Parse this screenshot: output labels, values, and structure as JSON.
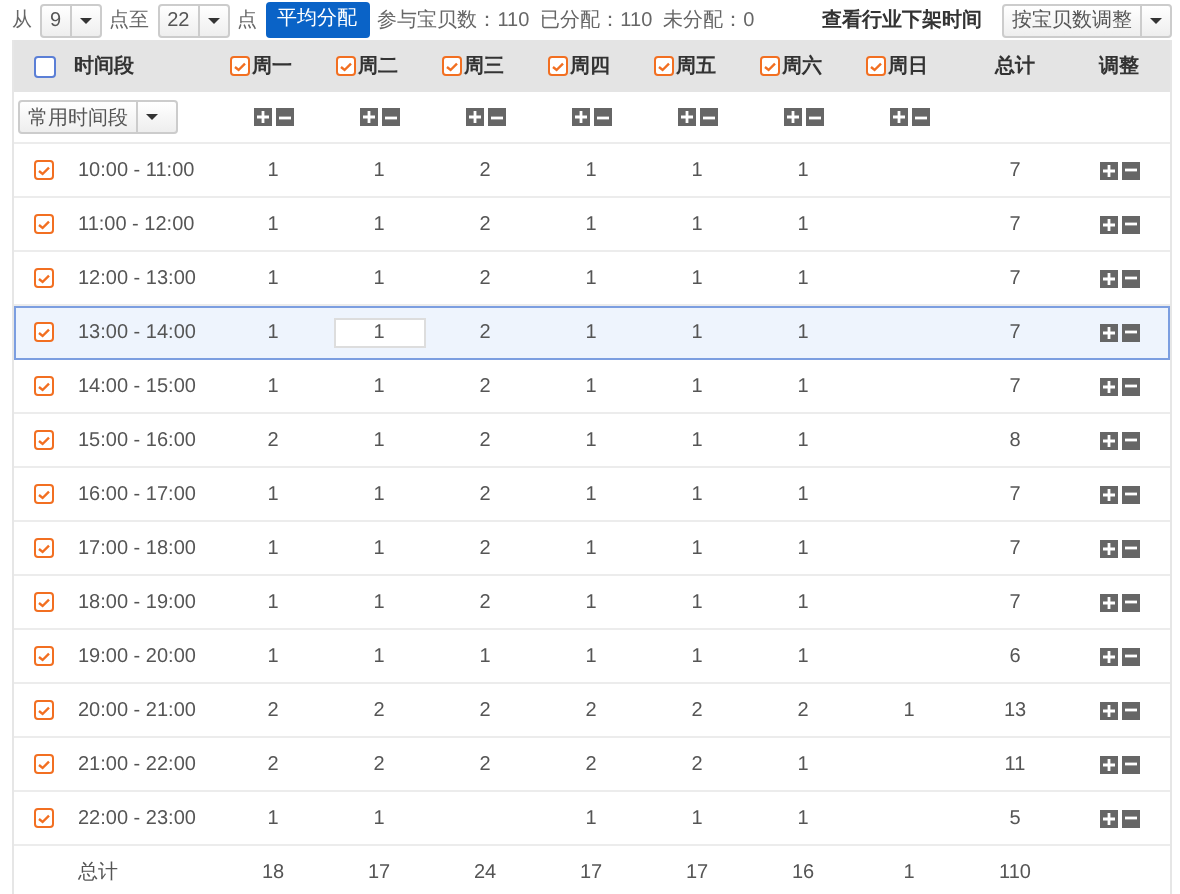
{
  "toolbar": {
    "from_label": "从",
    "from_select": "9",
    "to_label": "点至",
    "to_select": "22",
    "unit_label": "点",
    "average_button": "平均分配",
    "stats": "参与宝贝数：110  已分配：110  未分配：0",
    "industry_link": "查看行业下架时间",
    "adjust_select": "按宝贝数调整"
  },
  "header": {
    "select_all": {
      "checked": false
    },
    "time_label": "时间段",
    "days": [
      {
        "label": "周一",
        "checked": true
      },
      {
        "label": "周二",
        "checked": true
      },
      {
        "label": "周三",
        "checked": true
      },
      {
        "label": "周四",
        "checked": true
      },
      {
        "label": "周五",
        "checked": true
      },
      {
        "label": "周六",
        "checked": true
      },
      {
        "label": "周日",
        "checked": true
      }
    ],
    "total_label": "总计",
    "adjust_label": "调整"
  },
  "preset_select": "常用时间段",
  "rows": [
    {
      "time": "10:00 - 11:00",
      "checked": true,
      "selected": false,
      "cells": [
        {
          "kind": "text",
          "value": "1"
        },
        {
          "kind": "text",
          "value": "1"
        },
        {
          "kind": "text",
          "value": "2"
        },
        {
          "kind": "text",
          "value": "1"
        },
        {
          "kind": "text",
          "value": "1"
        },
        {
          "kind": "text",
          "value": "1"
        },
        null
      ],
      "total": "7"
    },
    {
      "time": "11:00 - 12:00",
      "checked": true,
      "selected": false,
      "cells": [
        {
          "kind": "text",
          "value": "1"
        },
        {
          "kind": "text",
          "value": "1"
        },
        {
          "kind": "text",
          "value": "2"
        },
        {
          "kind": "text",
          "value": "1"
        },
        {
          "kind": "text",
          "value": "1"
        },
        {
          "kind": "text",
          "value": "1"
        },
        null
      ],
      "total": "7"
    },
    {
      "time": "12:00 - 13:00",
      "checked": true,
      "selected": false,
      "cells": [
        {
          "kind": "text",
          "value": "1"
        },
        {
          "kind": "text",
          "value": "1"
        },
        {
          "kind": "text",
          "value": "2"
        },
        {
          "kind": "text",
          "value": "1"
        },
        {
          "kind": "text",
          "value": "1"
        },
        {
          "kind": "text",
          "value": "1"
        },
        null
      ],
      "total": "7"
    },
    {
      "time": "13:00 - 14:00",
      "checked": true,
      "selected": true,
      "cells": [
        {
          "kind": "text",
          "value": "1"
        },
        {
          "kind": "input",
          "value": "1"
        },
        {
          "kind": "text",
          "value": "2"
        },
        {
          "kind": "text",
          "value": "1"
        },
        {
          "kind": "text",
          "value": "1"
        },
        {
          "kind": "text",
          "value": "1"
        },
        null
      ],
      "total": "7"
    },
    {
      "time": "14:00 - 15:00",
      "checked": true,
      "selected": false,
      "cells": [
        {
          "kind": "text",
          "value": "1"
        },
        {
          "kind": "text",
          "value": "1"
        },
        {
          "kind": "text",
          "value": "2"
        },
        {
          "kind": "text",
          "value": "1"
        },
        {
          "kind": "text",
          "value": "1"
        },
        {
          "kind": "text",
          "value": "1"
        },
        null
      ],
      "total": "7"
    },
    {
      "time": "15:00 - 16:00",
      "checked": true,
      "selected": false,
      "cells": [
        {
          "kind": "text",
          "value": "2"
        },
        {
          "kind": "text",
          "value": "1"
        },
        {
          "kind": "text",
          "value": "2"
        },
        {
          "kind": "text",
          "value": "1"
        },
        {
          "kind": "text",
          "value": "1"
        },
        {
          "kind": "text",
          "value": "1"
        },
        null
      ],
      "total": "8"
    },
    {
      "time": "16:00 - 17:00",
      "checked": true,
      "selected": false,
      "cells": [
        {
          "kind": "text",
          "value": "1"
        },
        {
          "kind": "text",
          "value": "1"
        },
        {
          "kind": "text",
          "value": "2"
        },
        {
          "kind": "text",
          "value": "1"
        },
        {
          "kind": "text",
          "value": "1"
        },
        {
          "kind": "text",
          "value": "1"
        },
        null
      ],
      "total": "7"
    },
    {
      "time": "17:00 - 18:00",
      "checked": true,
      "selected": false,
      "cells": [
        {
          "kind": "text",
          "value": "1"
        },
        {
          "kind": "text",
          "value": "1"
        },
        {
          "kind": "text",
          "value": "2"
        },
        {
          "kind": "text",
          "value": "1"
        },
        {
          "kind": "text",
          "value": "1"
        },
        {
          "kind": "text",
          "value": "1"
        },
        null
      ],
      "total": "7"
    },
    {
      "time": "18:00 - 19:00",
      "checked": true,
      "selected": false,
      "cells": [
        {
          "kind": "text",
          "value": "1"
        },
        {
          "kind": "text",
          "value": "1"
        },
        {
          "kind": "text",
          "value": "2"
        },
        {
          "kind": "text",
          "value": "1"
        },
        {
          "kind": "text",
          "value": "1"
        },
        {
          "kind": "text",
          "value": "1"
        },
        null
      ],
      "total": "7"
    },
    {
      "time": "19:00 - 20:00",
      "checked": true,
      "selected": false,
      "cells": [
        {
          "kind": "text",
          "value": "1"
        },
        {
          "kind": "text",
          "value": "1"
        },
        {
          "kind": "text",
          "value": "1"
        },
        {
          "kind": "text",
          "value": "1"
        },
        {
          "kind": "text",
          "value": "1"
        },
        {
          "kind": "text",
          "value": "1"
        },
        null
      ],
      "total": "6"
    },
    {
      "time": "20:00 - 21:00",
      "checked": true,
      "selected": false,
      "cells": [
        {
          "kind": "text",
          "value": "2"
        },
        {
          "kind": "text",
          "value": "2"
        },
        {
          "kind": "text",
          "value": "2"
        },
        {
          "kind": "text",
          "value": "2"
        },
        {
          "kind": "text",
          "value": "2"
        },
        {
          "kind": "text",
          "value": "2"
        },
        {
          "kind": "text",
          "value": "1"
        }
      ],
      "total": "13"
    },
    {
      "time": "21:00 - 22:00",
      "checked": true,
      "selected": false,
      "cells": [
        {
          "kind": "text",
          "value": "2"
        },
        {
          "kind": "text",
          "value": "2"
        },
        {
          "kind": "text",
          "value": "2"
        },
        {
          "kind": "text",
          "value": "2"
        },
        {
          "kind": "text",
          "value": "2"
        },
        {
          "kind": "text",
          "value": "1"
        },
        null
      ],
      "total": "11"
    },
    {
      "time": "22:00 - 23:00",
      "checked": true,
      "selected": false,
      "cells": [
        {
          "kind": "text",
          "value": "1"
        },
        {
          "kind": "text",
          "value": "1"
        },
        null,
        {
          "kind": "text",
          "value": "1"
        },
        {
          "kind": "text",
          "value": "1"
        },
        {
          "kind": "text",
          "value": "1"
        },
        null
      ],
      "total": "5"
    }
  ],
  "totals": {
    "label": "总计",
    "values": [
      "18",
      "17",
      "24",
      "17",
      "17",
      "16",
      "1"
    ],
    "grand_total": "110"
  }
}
